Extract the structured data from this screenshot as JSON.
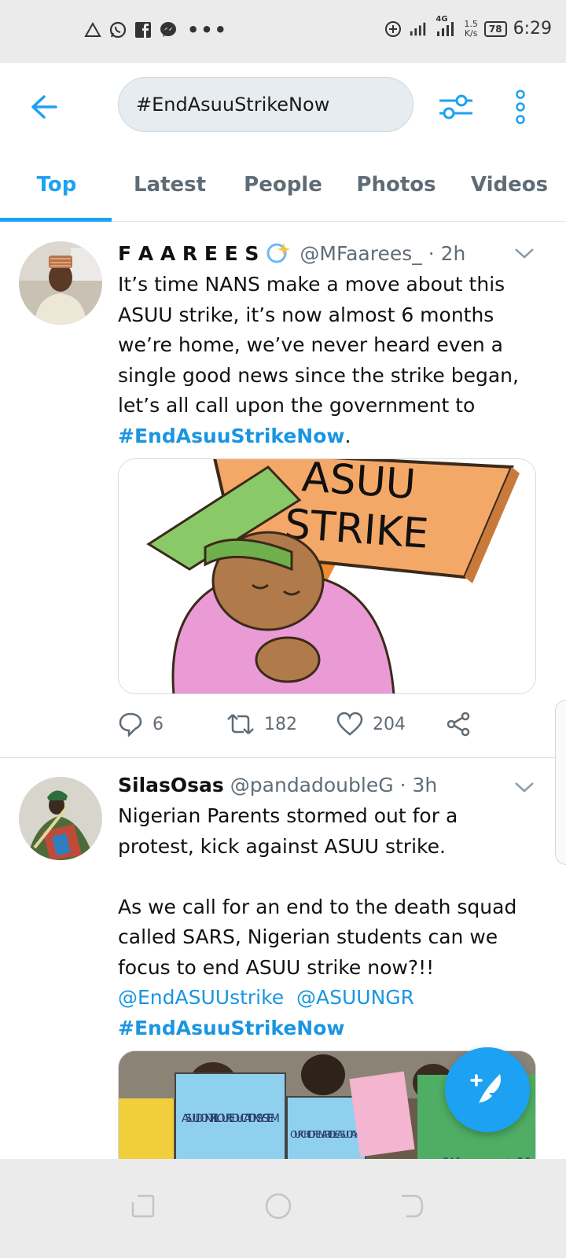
{
  "status_bar": {
    "network": "4G",
    "speed_value": "1.5",
    "speed_unit": "K/s",
    "battery": "78",
    "time": "6:29"
  },
  "search": {
    "query": "#EndAsuuStrikeNow"
  },
  "tabs": [
    {
      "label": "Top",
      "active": true
    },
    {
      "label": "Latest",
      "active": false
    },
    {
      "label": "People",
      "active": false
    },
    {
      "label": "Photos",
      "active": false
    },
    {
      "label": "Videos",
      "active": false
    }
  ],
  "accent_color": "#1da1f2",
  "tweets": [
    {
      "display_name": "F A A R E E S",
      "handle": "@MFaarees_",
      "time": "· 2h",
      "text": "It’s time NANS make a move about this ASUU strike, it’s now almost 6 months we’re home, we’ve never heard even a single good news since the strike began, let’s all call upon the government to",
      "hashtag": "#EndAsuuStrikeNow",
      "hashtag_suffix": ".",
      "image_sign_line1": "ASUU",
      "image_sign_line2": "STRIKE",
      "replies": "6",
      "retweets": "182",
      "likes": "204"
    },
    {
      "display_name": "SilasOsas",
      "handle": "@pandadoubleG",
      "time": "· 3h",
      "text_line1": "Nigerian Parents stormed out for a protest, kick against ASUU strike.",
      "text_line2": "As we call for an end to the death squad called SARS, Nigerian students can we focus to end ASUU strike now?!!",
      "mention1": "@EndASUUstrike",
      "mention2": "@ASUUNGR",
      "hashtag": "#EndAsuuStrikeNow",
      "placard1": "ASUU DONT KILL OUR EDUCATION SYSTEM",
      "placard2": "OUR CHILDREN ARE IDLE ASUU TAKE",
      "banner": "We want Unity"
    }
  ]
}
